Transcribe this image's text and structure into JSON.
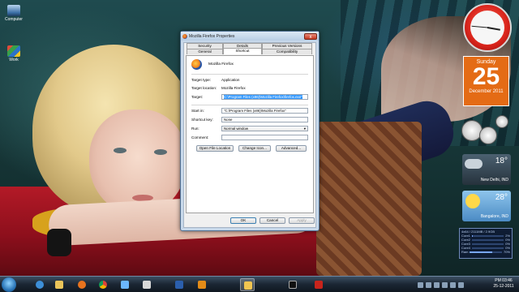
{
  "desktop": {
    "icons": [
      {
        "label": "Computer"
      },
      {
        "label": "Work"
      }
    ]
  },
  "dialog": {
    "title": "Mozilla Firefox Properties",
    "close_glyph": "x",
    "tabs_row1": [
      "Security",
      "Details",
      "Previous Versions"
    ],
    "tabs_row2": [
      "General",
      "Shortcut",
      "Compatibility"
    ],
    "active_tab": "Shortcut",
    "program_name": "Mozilla Firefox",
    "fields": {
      "target_type_label": "Target type:",
      "target_type": "Application",
      "target_location_label": "Target location:",
      "target_location": "Mozilla Firefox",
      "target_label": "Target:",
      "target": "C:\\Program Files (x86)\\Mozilla Firefox\\firefox.exe\"",
      "start_in_label": "Start in:",
      "start_in": "\"C:\\Program Files (x86)\\Mozilla Firefox\"",
      "shortcut_key_label": "Shortcut key:",
      "shortcut_key": "None",
      "run_label": "Run:",
      "run": "Normal window",
      "comment_label": "Comment:",
      "comment": ""
    },
    "buttons": {
      "open_file_location": "Open File Location",
      "change_icon": "Change Icon...",
      "advanced": "Advanced...",
      "ok": "OK",
      "cancel": "Cancel",
      "apply": "Apply"
    }
  },
  "gadgets": {
    "calendar": {
      "day_of_week": "Sunday",
      "day": "25",
      "month_year": "December 2011"
    },
    "weather": [
      {
        "temp": "18°",
        "city": "New Delhi, IND"
      },
      {
        "temp": "28°",
        "city": "Bangalore, IND"
      }
    ],
    "meter": {
      "header": "4x64 / 2111MB / 2.9GB",
      "lines": [
        {
          "label": "Core1",
          "value": "2%",
          "fill": 0.02
        },
        {
          "label": "Core2",
          "value": "0%",
          "fill": 0.0
        },
        {
          "label": "Core3",
          "value": "0%",
          "fill": 0.0
        },
        {
          "label": "Core4",
          "value": "0%",
          "fill": 0.0
        },
        {
          "label": "Ram",
          "value": "70%",
          "fill": 0.7
        }
      ]
    }
  },
  "taskbar": {
    "time": "PM 03:46",
    "date": "25-12-2011",
    "apps": [
      "ie-icon",
      "firefox-icon",
      "chrome-icon",
      "explorer-icon",
      "media-icon",
      "word-icon",
      "outlook-icon",
      "folder-icon",
      "cmd-icon",
      "acrobat-icon"
    ]
  },
  "colors": {
    "accent_orange": "#e46b15",
    "selection_blue": "#3399ff",
    "clock_red": "#d9241b"
  }
}
